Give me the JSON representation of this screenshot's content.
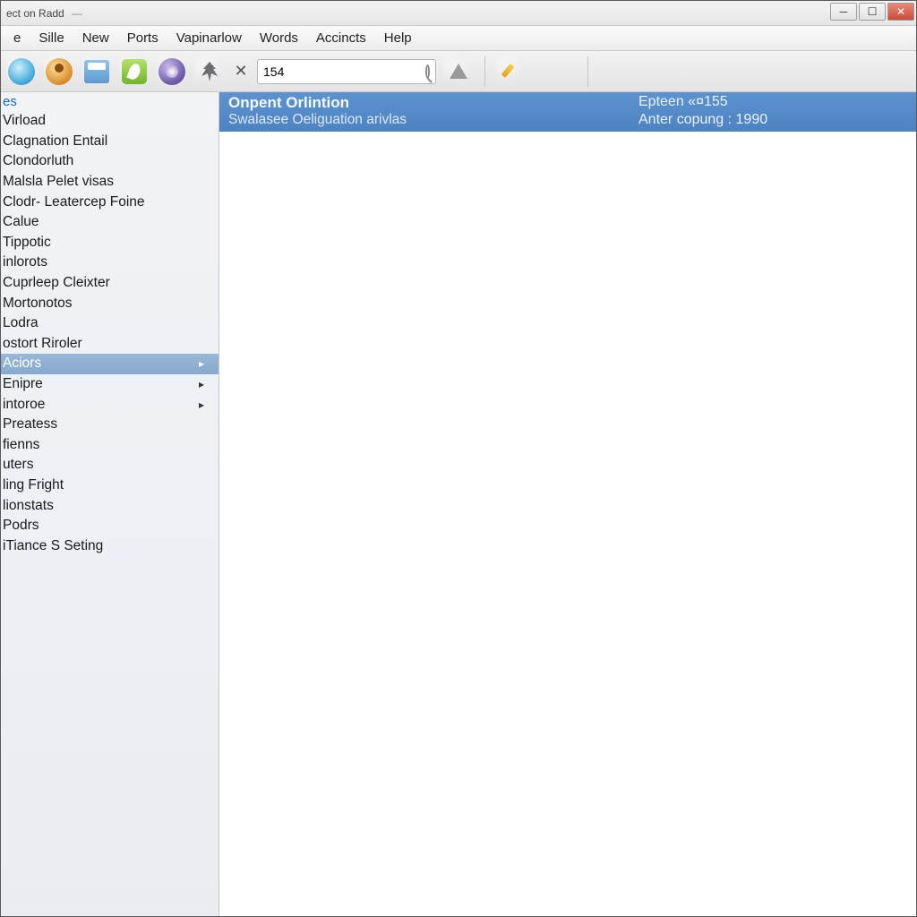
{
  "titlebar": {
    "title": "ect on Radd"
  },
  "menu": {
    "items": [
      "e",
      "Sille",
      "New",
      "Ports",
      "Vapinarlow",
      "Words",
      "Accincts",
      "Help"
    ]
  },
  "toolbar": {
    "search_value": "154"
  },
  "sidebar": {
    "header": "es",
    "items": [
      {
        "label": "Virload",
        "expand": false
      },
      {
        "label": "Clagnation Entail",
        "expand": false
      },
      {
        "label": "Clondorluth",
        "expand": false
      },
      {
        "label": "Malsla Pelet visas",
        "expand": false
      },
      {
        "label": "Clodr- Leatercep Foine",
        "expand": false
      },
      {
        "label": "Calue",
        "expand": false
      },
      {
        "label": "Tippotic",
        "expand": false
      },
      {
        "label": "inlorots",
        "expand": false
      },
      {
        "label": "Cuprleep Cleixter",
        "expand": false
      },
      {
        "label": "Mortonotos",
        "expand": false
      },
      {
        "label": "Lodra",
        "expand": false
      },
      {
        "label": "ostort Riroler",
        "expand": false
      },
      {
        "label": "Aciors",
        "expand": true,
        "selected": true
      },
      {
        "label": "Enipre",
        "expand": true
      },
      {
        "label": "intoroe",
        "expand": true
      },
      {
        "label": "Preatess",
        "expand": false
      },
      {
        "label": "fienns",
        "expand": false
      },
      {
        "label": "uters",
        "expand": false
      },
      {
        "label": "ling Fright",
        "expand": false
      },
      {
        "label": "lionstats",
        "expand": false
      },
      {
        "label": "Podrs",
        "expand": false
      },
      {
        "label": "iTiance S Seting",
        "expand": false
      }
    ]
  },
  "band": {
    "title": "Onpent Orlintion",
    "subtitle": "Swalasee Oeliguation arivlas",
    "right1_label": "Epteen",
    "right1_value": "«¤155",
    "right2_label": "Anter copung",
    "right2_value": "1990"
  }
}
